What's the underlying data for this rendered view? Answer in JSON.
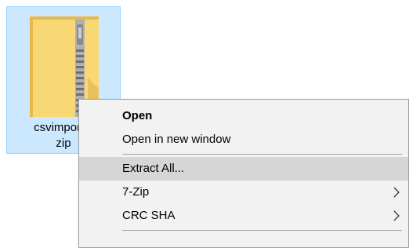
{
  "file": {
    "name_line1": "csvimport_i",
    "name_line2": "zip",
    "icon": "zip-folder-icon"
  },
  "context_menu": {
    "items": [
      {
        "label": "Open",
        "bold": true
      },
      {
        "label": "Open in new window"
      },
      {
        "label": "Extract All...",
        "highlighted": true
      },
      {
        "label": "7-Zip",
        "submenu": true,
        "icon": "chevron-right-icon"
      },
      {
        "label": "CRC SHA",
        "submenu": true,
        "icon": "chevron-right-icon"
      }
    ]
  },
  "colors": {
    "selection_bg": "#cce8ff",
    "selection_border": "#99d1ff",
    "menu_bg": "#f2f2f2",
    "menu_highlight": "#d6d6d6",
    "folder_yellow": "#f8d775"
  }
}
